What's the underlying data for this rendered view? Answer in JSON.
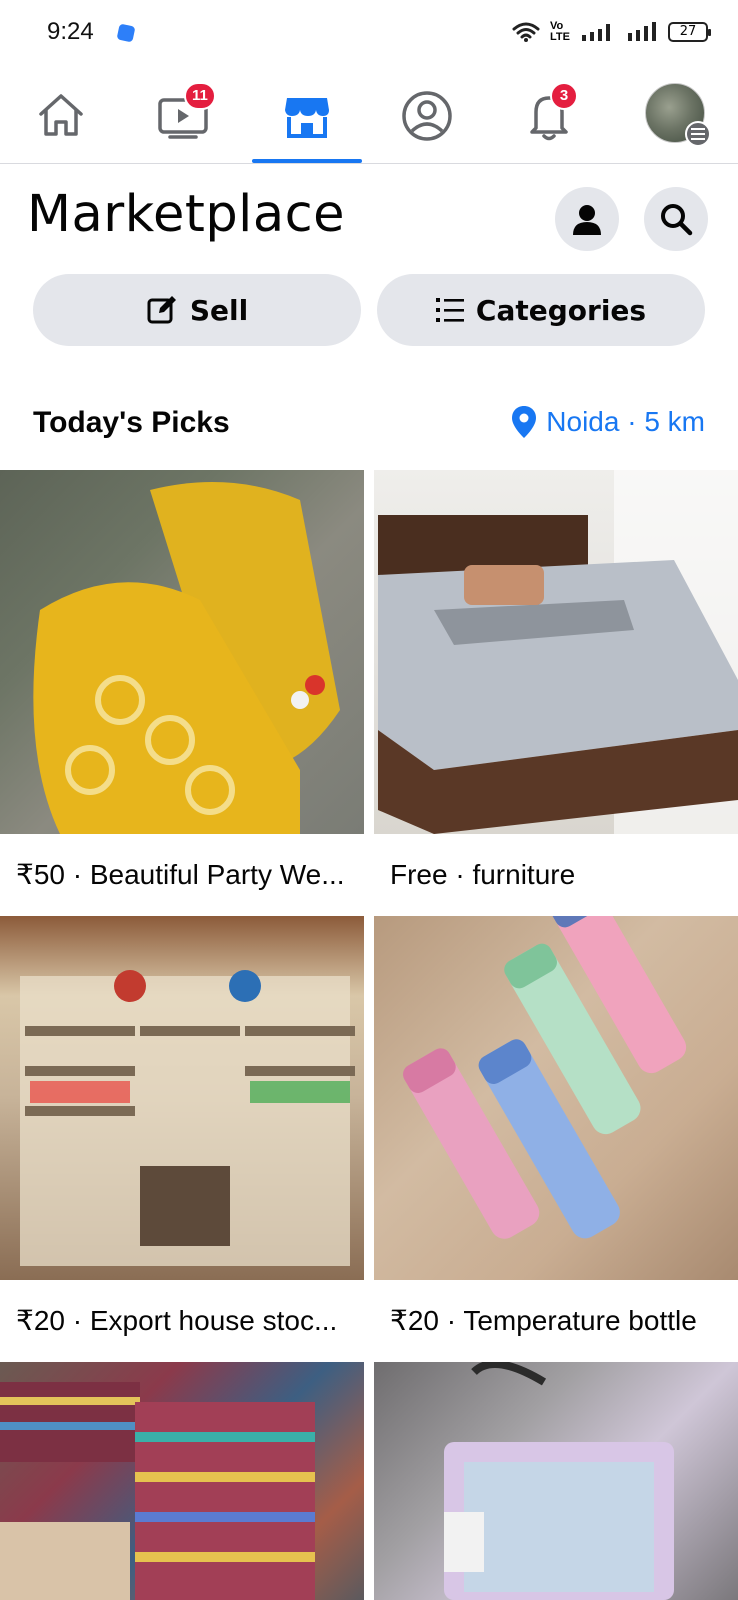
{
  "status_bar": {
    "time": "9:24",
    "network_label": "Vo LTE",
    "battery": "27"
  },
  "nav": {
    "tabs": [
      {
        "name": "home",
        "icon": "home-icon",
        "badge": ""
      },
      {
        "name": "watch",
        "icon": "video-icon",
        "badge": "11"
      },
      {
        "name": "marketplace",
        "icon": "marketplace-icon",
        "badge": "",
        "active": true
      },
      {
        "name": "profile",
        "icon": "profile-icon",
        "badge": ""
      },
      {
        "name": "notifications",
        "icon": "bell-icon",
        "badge": "3"
      },
      {
        "name": "menu",
        "icon": "avatar-menu-icon",
        "badge": ""
      }
    ]
  },
  "header": {
    "title": "Marketplace"
  },
  "actions": {
    "sell_label": "Sell",
    "categories_label": "Categories"
  },
  "section": {
    "title": "Today's Picks",
    "location": "Noida · 5 km"
  },
  "listings": [
    {
      "label": "₹50 · Beautiful Party We...",
      "image": "yellow embroidered dress"
    },
    {
      "label": "Free · furniture",
      "image": "wooden bed"
    },
    {
      "label": "₹20 · Export house stoc...",
      "image": "home decor shop"
    },
    {
      "label": "₹20 · Temperature bottle",
      "image": "pastel bottles"
    },
    {
      "label": "",
      "image": "striped fabric"
    },
    {
      "label": "",
      "image": "sequin bag"
    }
  ],
  "colors": {
    "accent": "#1877f2",
    "badge": "#e41e3f",
    "pill_bg": "#e4e6eb",
    "text": "#050505"
  }
}
